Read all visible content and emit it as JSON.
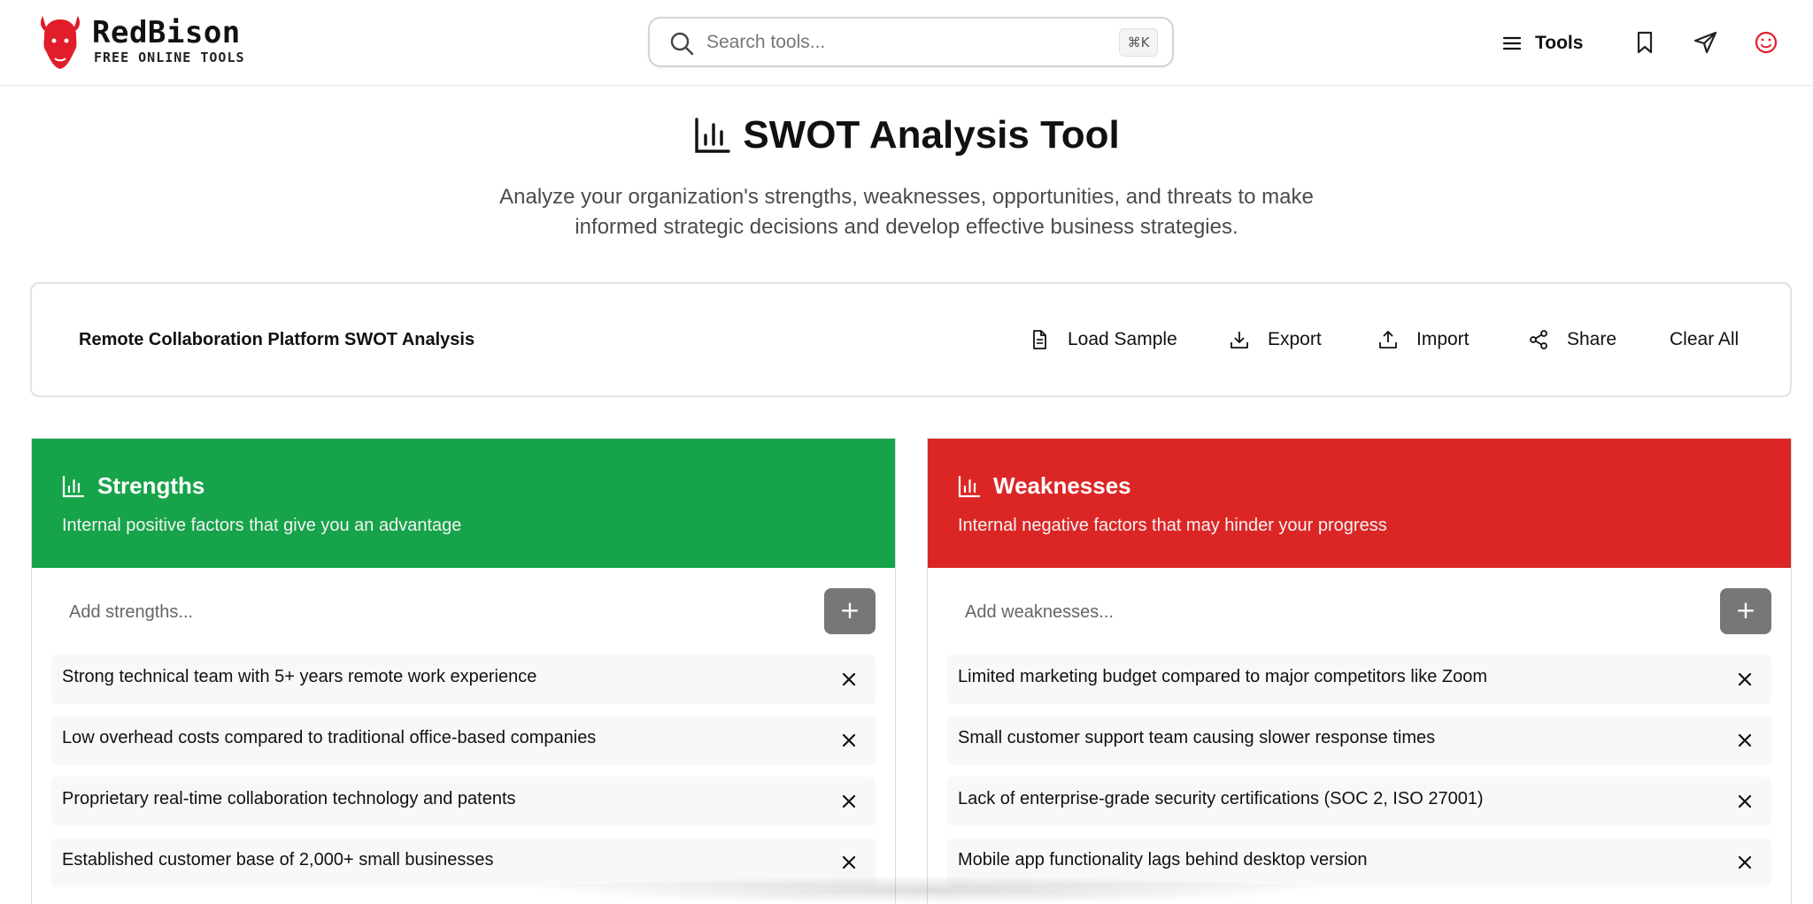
{
  "colors": {
    "strengths": "#16a34a",
    "weaknesses": "#dc2626",
    "brand": "#e11d2a",
    "add_button": "#777777"
  },
  "header": {
    "logo": {
      "name": "RedBison",
      "tagline": "FREE ONLINE TOOLS",
      "icon": "bison-icon"
    },
    "search": {
      "placeholder": "Search tools...",
      "shortcut": "⌘K"
    },
    "nav": {
      "tools_label": "Tools",
      "icons": [
        "menu-icon",
        "bookmark-icon",
        "send-icon",
        "smiley-icon"
      ]
    }
  },
  "page": {
    "title": "SWOT Analysis Tool",
    "subtitle": "Analyze your organization's strengths, weaknesses, opportunities, and threats to make informed strategic decisions and develop effective business strategies."
  },
  "toolbar": {
    "project_name": "Remote Collaboration Platform SWOT Analysis",
    "load_sample": "Load Sample",
    "export": "Export",
    "import": "Import",
    "share": "Share",
    "clear_all": "Clear All"
  },
  "strengths": {
    "title": "Strengths",
    "description": "Internal positive factors that give you an advantage",
    "placeholder": "Add strengths...",
    "add_label": "+",
    "items": [
      "Strong technical team with 5+ years remote work experience",
      "Low overhead costs compared to traditional office-based companies",
      "Proprietary real-time collaboration technology and patents",
      "Established customer base of 2,000+ small businesses"
    ]
  },
  "weaknesses": {
    "title": "Weaknesses",
    "description": "Internal negative factors that may hinder your progress",
    "placeholder": "Add weaknesses...",
    "add_label": "+",
    "items": [
      "Limited marketing budget compared to major competitors like Zoom",
      "Small customer support team causing slower response times",
      "Lack of enterprise-grade security certifications (SOC 2, ISO 27001)",
      "Mobile app functionality lags behind desktop version"
    ]
  }
}
